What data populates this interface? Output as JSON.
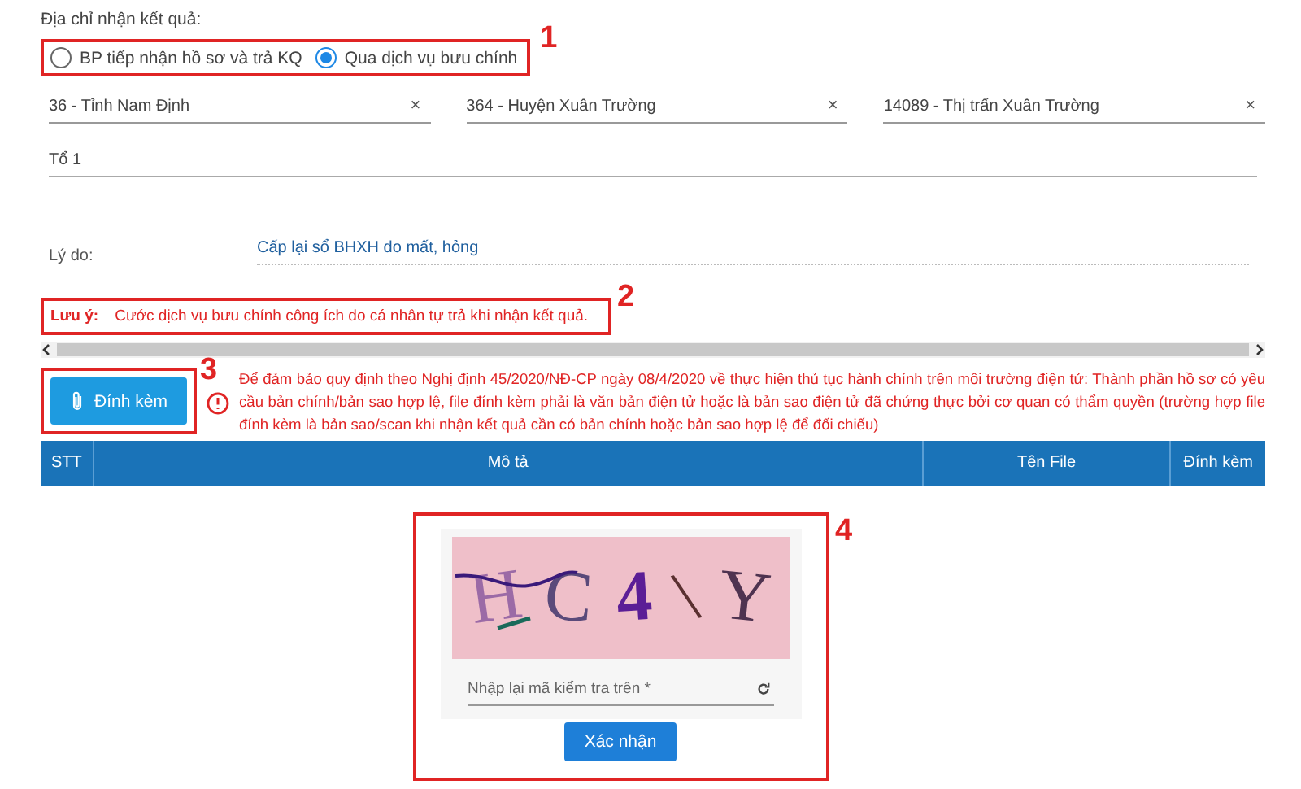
{
  "result_address": {
    "label": "Địa chỉ nhận kết quả:",
    "annotation": "1",
    "options": [
      {
        "label": "BP tiếp nhận hồ sơ và trả KQ",
        "selected": false
      },
      {
        "label": "Qua dịch vụ bưu chính",
        "selected": true
      }
    ],
    "selects": [
      {
        "value": "36 - Tỉnh Nam Định",
        "clear": "×"
      },
      {
        "value": "364 - Huyện Xuân Trường",
        "clear": "×"
      },
      {
        "value": "14089 - Thị trấn Xuân Trường",
        "clear": "×"
      }
    ],
    "address_line": {
      "value": "Tổ 1"
    }
  },
  "reason": {
    "label": "Lý do:",
    "value": "Cấp lại sổ BHXH do mất, hỏng"
  },
  "note": {
    "annotation": "2",
    "label": "Lưu ý:",
    "text": "Cước dịch vụ bưu chính công ích do cá nhân tự trả khi nhận kết quả."
  },
  "attach": {
    "annotation": "3",
    "button": "Đính kèm",
    "warning": "Để đảm bảo quy định theo Nghị định 45/2020/NĐ-CP ngày 08/4/2020 về thực hiện thủ tục hành chính trên môi trường điện tử: Thành phần hồ sơ có yêu cầu bản chính/bản sao hợp lệ, file đính kèm phải là văn bản điện tử hoặc là bản sao điện tử đã chứng thực bởi cơ quan có thẩm quyền (trường hợp file đính kèm là bản sao/scan khi nhận kết quả cần có bản chính hoặc bản sao hợp lệ để đối chiếu)"
  },
  "table": {
    "columns": [
      "STT",
      "Mô tả",
      "Tên File",
      "Đính kèm"
    ]
  },
  "captcha": {
    "annotation": "4",
    "chars": [
      {
        "text": "H",
        "color": "#9b6aa6"
      },
      {
        "text": "C",
        "color": "#5a4a7a"
      },
      {
        "text": "4",
        "color": "#5b1e96"
      },
      {
        "text": "\\",
        "color": "#5a3030"
      },
      {
        "text": "Y",
        "color": "#4f3350"
      }
    ],
    "placeholder": "Nhập lại mã kiểm tra trên *",
    "button": "Xác nhận"
  }
}
